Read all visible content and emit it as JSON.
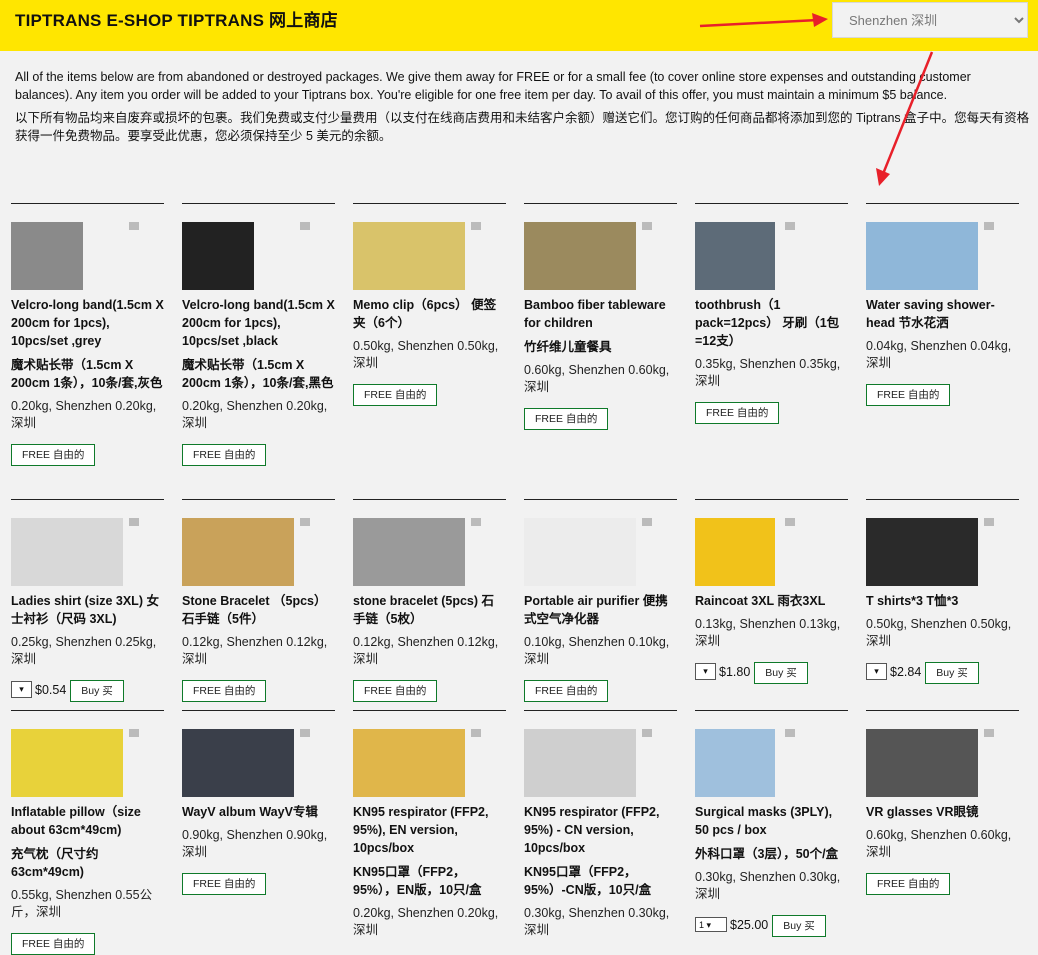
{
  "header": {
    "title": "TIPTRANS E-SHOP  TIPTRANS 网上商店",
    "location_select": "Shenzhen 深圳"
  },
  "intro": {
    "en": "All of the items below are from abandoned or destroyed packages. We give them away for FREE or for a small fee (to cover online store expenses and outstanding customer balances). Any item you order will be added to your Tiptrans box. You're eligible for one free item per day. To avail of this offer, you must maintain a minimum $5 balance.",
    "zh": "以下所有物品均来自废弃或损坏的包裹。我们免费或支付少量费用（以支付在线商店费用和未结客户余额）赠送它们。您订购的任何商品都将添加到您的 Tiptrans 盒子中。您每天有资格获得一件免费物品。要享受此优惠，您必须保持至少 5 美元的余额。"
  },
  "products": [
    {
      "title": "Velcro-long band(1.5cm X 200cm for 1pcs), 10pcs/set ,grey",
      "title_zh": "魔术贴长带（1.5cm X 200cm 1条），10条/套,灰色",
      "meta": "0.20kg, Shenzhen 0.20kg, 深圳",
      "button": "FREE 自由的",
      "kind": "free",
      "img": "#8a8a8a"
    },
    {
      "title": "Velcro-long band(1.5cm X 200cm for 1pcs), 10pcs/set ,black",
      "title_zh": "魔术贴长带（1.5cm X 200cm 1条），10条/套,黑色",
      "meta": "0.20kg, Shenzhen 0.20kg, 深圳",
      "button": "FREE 自由的",
      "kind": "free",
      "img": "#222222"
    },
    {
      "title": "Memo clip（6pcs） 便签夹（6个）",
      "title_zh": "",
      "meta": "0.50kg, Shenzhen 0.50kg, 深圳",
      "button": "FREE 自由的",
      "kind": "free",
      "img": "#d9c36a"
    },
    {
      "title": "Bamboo fiber tableware for children",
      "title_zh": "竹纤维儿童餐具",
      "meta": "0.60kg, Shenzhen 0.60kg, 深圳",
      "button": "FREE 自由的",
      "kind": "free",
      "img": "#9b8a5e"
    },
    {
      "title": "toothbrush（1 pack=12pcs） 牙刷（1包=12支）",
      "title_zh": "",
      "meta": "0.35kg, Shenzhen 0.35kg, 深圳",
      "button": "FREE 自由的",
      "kind": "free",
      "img": "#5d6b78"
    },
    {
      "title": "Water saving shower-head 节水花洒",
      "title_zh": "",
      "meta": "0.04kg, Shenzhen 0.04kg, 深圳",
      "button": "FREE 自由的",
      "kind": "free",
      "img": "#8fb7d9"
    },
    {
      "title": "Ladies shirt (size 3XL) 女士衬衫（尺码 3XL)",
      "title_zh": "",
      "meta": "0.25kg, Shenzhen 0.25kg, 深圳",
      "button": "Buy 买",
      "kind": "buy",
      "price": "$0.54",
      "qty": "",
      "img": "#d8d8d8"
    },
    {
      "title": "Stone Bracelet （5pcs） 石手链（5件）",
      "title_zh": "",
      "meta": "0.12kg, Shenzhen 0.12kg, 深圳",
      "button": "FREE 自由的",
      "kind": "free",
      "img": "#c9a25a"
    },
    {
      "title": "stone bracelet (5pcs) 石手链（5枚）",
      "title_zh": "",
      "meta": "0.12kg, Shenzhen 0.12kg, 深圳",
      "button": "FREE 自由的",
      "kind": "free",
      "img": "#9a9a9a"
    },
    {
      "title": "Portable air purifier 便携式空气净化器",
      "title_zh": "",
      "meta": "0.10kg, Shenzhen 0.10kg, 深圳",
      "button": "FREE 自由的",
      "kind": "free",
      "img": "#ececec"
    },
    {
      "title": "Raincoat 3XL 雨衣3XL",
      "title_zh": "",
      "meta": "0.13kg, Shenzhen 0.13kg, 深圳",
      "button": "Buy 买",
      "kind": "buy",
      "price": "$1.80",
      "qty": "",
      "img": "#f1c21a"
    },
    {
      "title": "T shirts*3 T恤*3",
      "title_zh": "",
      "meta": "0.50kg, Shenzhen 0.50kg, 深圳",
      "button": "Buy 买",
      "kind": "buy",
      "price": "$2.84",
      "qty": "",
      "img": "#2a2a2a"
    },
    {
      "title": "Inflatable pillow（size about 63cm*49cm)",
      "title_zh": "充气枕（尺寸约63cm*49cm)",
      "meta": "0.55kg, Shenzhen 0.55公斤，深圳",
      "button": "FREE 自由的",
      "kind": "free",
      "img": "#e8d23a"
    },
    {
      "title": "WayV album WayV专辑",
      "title_zh": "",
      "meta": "0.90kg, Shenzhen 0.90kg, 深圳",
      "button": "FREE 自由的",
      "kind": "free",
      "img": "#3a3f4a"
    },
    {
      "title": "KN95 respirator (FFP2, 95%), EN version, 10pcs/box",
      "title_zh": "KN95口罩（FFP2，95%），EN版，10只/盒",
      "meta": "0.20kg, Shenzhen 0.20kg, 深圳",
      "button": "",
      "kind": "none",
      "img": "#e0b64a"
    },
    {
      "title": "KN95 respirator (FFP2, 95%) - CN version, 10pcs/box",
      "title_zh": "KN95口罩（FFP2，95%）-CN版，10只/盒",
      "meta": "0.30kg, Shenzhen 0.30kg, 深圳",
      "button": "",
      "kind": "none",
      "img": "#cfcfcf"
    },
    {
      "title": "Surgical masks (3PLY), 50 pcs / box",
      "title_zh": "外科口罩（3层），50个/盒",
      "meta": "0.30kg, Shenzhen 0.30kg, 深圳",
      "button": "Buy 买",
      "kind": "buy",
      "price": "$25.00",
      "qty": "1",
      "img": "#9fc0dd"
    },
    {
      "title": "VR glasses VR眼镜",
      "title_zh": "",
      "meta": "0.60kg, Shenzhen 0.60kg, 深圳",
      "button": "FREE 自由的",
      "kind": "free",
      "img": "#555555"
    }
  ],
  "colors": {
    "header": "#ffe600",
    "button_border": "#0f7a2a",
    "arrow": "#e8202a"
  }
}
